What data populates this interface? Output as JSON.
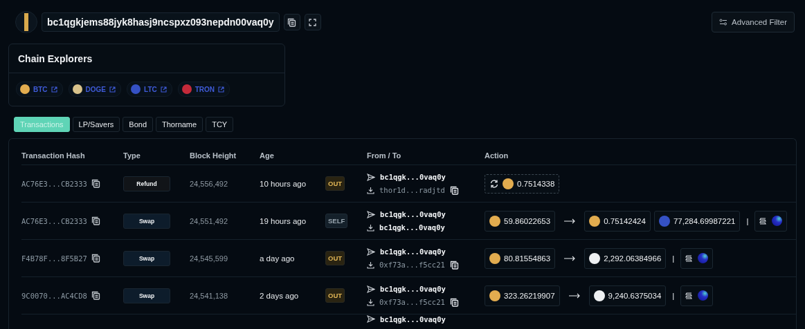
{
  "address": {
    "text": "bc1qgkjems88jyk8hasj9ncspxz093nepdn00vaq0y"
  },
  "advanced_filter": {
    "label": "Advanced Filter"
  },
  "chain_explorers": {
    "title": "Chain Explorers",
    "links": [
      {
        "label": "BTC",
        "kind": "btc"
      },
      {
        "label": "DOGE",
        "kind": "doge"
      },
      {
        "label": "LTC",
        "kind": "ltc"
      },
      {
        "label": "TRON",
        "kind": "tron"
      }
    ]
  },
  "tabs": [
    {
      "label": "Transactions",
      "selected": true
    },
    {
      "label": "LP/Savers",
      "selected": false
    },
    {
      "label": "Bond",
      "selected": false
    },
    {
      "label": "Thorname",
      "selected": false
    },
    {
      "label": "TCY",
      "selected": false
    }
  ],
  "table": {
    "columns": [
      "Transaction Hash",
      "Type",
      "Block Height",
      "Age",
      "From / To",
      "Action"
    ],
    "rows": [
      {
        "hash": "AC76E3...CB2333",
        "type": {
          "label": "Refund",
          "kind": "refund"
        },
        "block": "24,556,492",
        "age": "10 hours ago",
        "direction": {
          "label": "OUT",
          "kind": "out"
        },
        "from": "bc1qgk...0vaq0y",
        "to": {
          "text": "thor1d...radjtd",
          "copyable": true
        },
        "action": {
          "kind": "refund",
          "asset": {
            "kind": "btc",
            "amount": "0.7514338"
          }
        }
      },
      {
        "hash": "AC76E3...CB2333",
        "type": {
          "label": "Swap",
          "kind": "swap"
        },
        "block": "24,551,492",
        "age": "19 hours ago",
        "direction": {
          "label": "SELF",
          "kind": "self"
        },
        "from": "bc1qgk...0vaq0y",
        "to": {
          "text": "bc1qgk...0vaq0y",
          "copyable": false
        },
        "action": {
          "kind": "swap",
          "inputs": [
            {
              "kind": "btc",
              "amount": "59.86022653"
            }
          ],
          "outputs": [
            {
              "kind": "btc",
              "amount": "0.75142424"
            },
            {
              "kind": "ltc",
              "amount": "77,284.69987221"
            }
          ],
          "separator": "|"
        }
      },
      {
        "hash": "F4B78F...8F5B27",
        "type": {
          "label": "Swap",
          "kind": "swap"
        },
        "block": "24,545,599",
        "age": "a day ago",
        "direction": {
          "label": "OUT",
          "kind": "out"
        },
        "from": "bc1qgk...0vaq0y",
        "to": {
          "text": "0xf73a...f5cc21",
          "copyable": true
        },
        "action": {
          "kind": "swap",
          "inputs": [
            {
              "kind": "btc",
              "amount": "80.81554863"
            }
          ],
          "outputs": [
            {
              "kind": "eth",
              "amount": "2,292.06384966"
            }
          ],
          "separator": "|"
        }
      },
      {
        "hash": "9C0070...AC4CD8",
        "type": {
          "label": "Swap",
          "kind": "swap"
        },
        "block": "24,541,138",
        "age": "2 days ago",
        "direction": {
          "label": "OUT",
          "kind": "out"
        },
        "from": "bc1qgk...0vaq0y",
        "to": {
          "text": "0xf73a...f5cc21",
          "copyable": true
        },
        "action": {
          "kind": "swap",
          "inputs": [
            {
              "kind": "btc",
              "amount": "323.26219907"
            }
          ],
          "outputs": [
            {
              "kind": "eth",
              "amount": "9,240.6375034"
            }
          ],
          "separator": "|"
        }
      },
      {
        "from": "bc1qgk...0vaq0y"
      }
    ]
  }
}
